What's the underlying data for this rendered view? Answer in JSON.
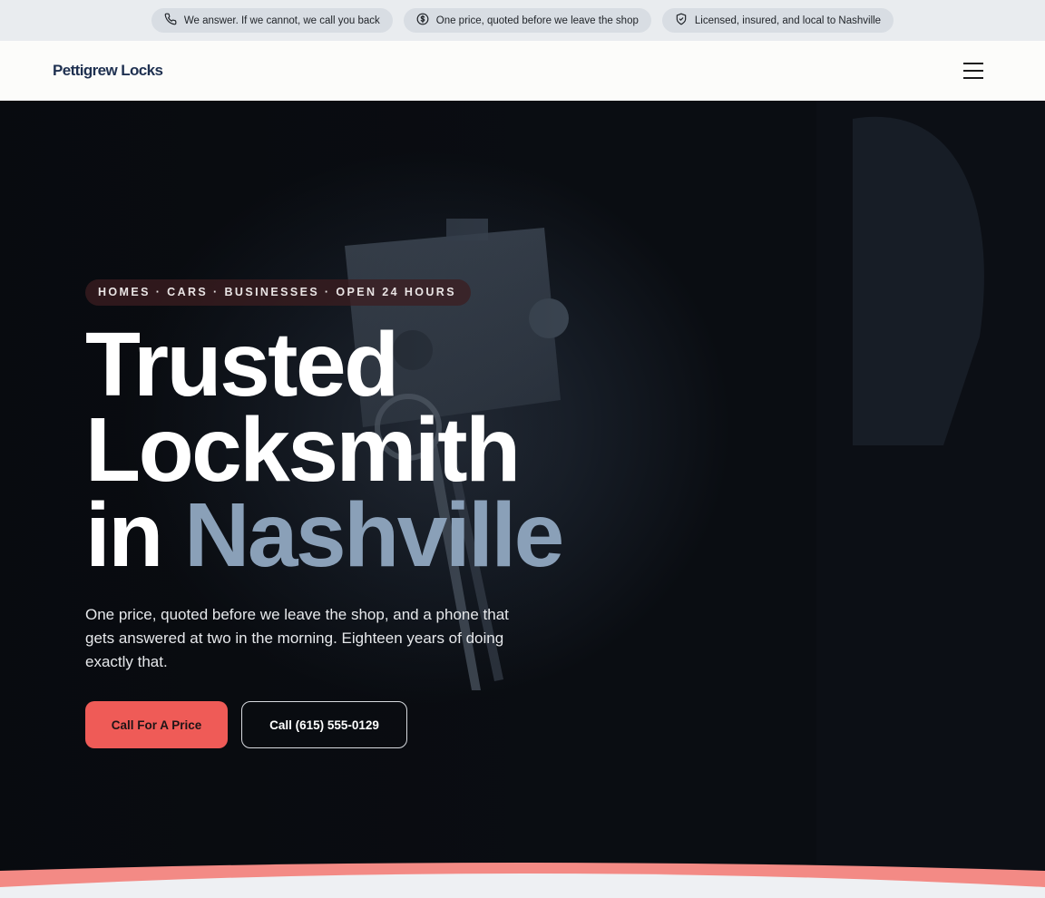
{
  "topbar": {
    "items": [
      {
        "icon": "phone-icon",
        "label": "We answer. If we cannot, we call you back"
      },
      {
        "icon": "dollar-circle-icon",
        "label": "One price, quoted before we leave the shop"
      },
      {
        "icon": "shield-check-icon",
        "label": "Licensed, insured, and local to Nashville"
      }
    ]
  },
  "header": {
    "logo": "Pettigrew Locks",
    "menu_icon": "hamburger-menu-icon"
  },
  "hero": {
    "eyebrow": "HOMES · CARS · BUSINESSES · OPEN 24 HOURS",
    "headline_line1": "Trusted",
    "headline_line2": "Locksmith",
    "headline_line3_prefix": "in",
    "headline_line3_accent": "Nashville",
    "lede": "One price, quoted before we leave the shop, and a phone that gets answered at two in the morning. Eighteen years of doing exactly that.",
    "primary_cta": "Call For A Price",
    "secondary_cta": "Call (615) 555-0129"
  },
  "colors": {
    "accent": "#ef5b57",
    "headline_accent": "#8aa0b8",
    "brand": "#1e3050"
  }
}
